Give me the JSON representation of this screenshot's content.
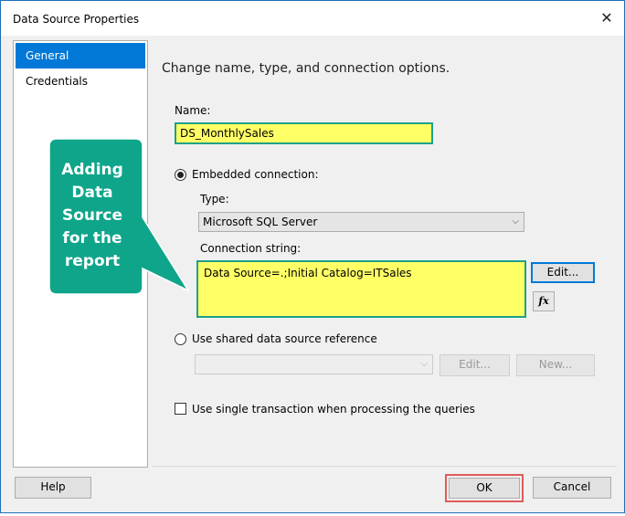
{
  "window": {
    "title": "Data Source Properties",
    "close_glyph": "✕"
  },
  "nav": {
    "items": [
      {
        "label": "General",
        "selected": true
      },
      {
        "label": "Credentials",
        "selected": false
      }
    ]
  },
  "general": {
    "heading": "Change name, type, and connection options.",
    "name_label": "Name:",
    "name_value": "DS_MonthlySales",
    "embedded_label": "Embedded connection:",
    "type_label": "Type:",
    "type_value": "Microsoft SQL Server",
    "conn_label": "Connection string:",
    "conn_value": "Data Source=.;Initial Catalog=ITSales",
    "edit_label": "Edit...",
    "fx_label": "fx",
    "shared_label": "Use shared data source reference",
    "shared_value": "",
    "shared_edit_label": "Edit...",
    "shared_new_label": "New...",
    "transaction_label": "Use single transaction when processing the queries"
  },
  "footer": {
    "help_label": "Help",
    "ok_label": "OK",
    "cancel_label": "Cancel"
  },
  "annotation": {
    "lines": [
      "Adding",
      "Data",
      "Source",
      "for the",
      "report"
    ],
    "color": "#0fa58a",
    "ok_highlight_color": "#e05a5a"
  },
  "colors": {
    "accent": "#0078d7",
    "highlight_fill": "#ffff66",
    "highlight_border": "#1ca18a"
  }
}
